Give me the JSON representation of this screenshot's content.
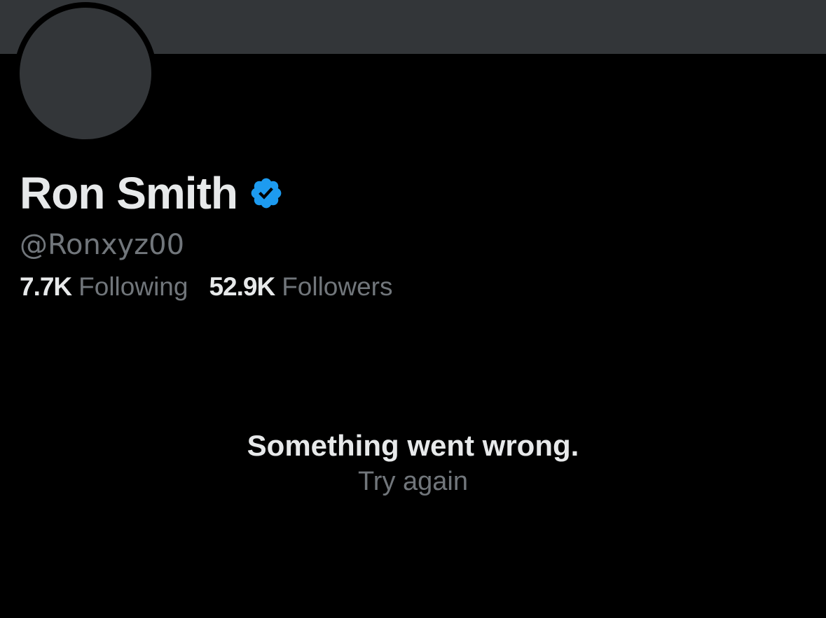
{
  "profile": {
    "display_name": "Ron Smith",
    "handle": "@Ronxyz00",
    "verified_icon": "verified-badge-icon",
    "badge_color": "#1d9bf0"
  },
  "stats": {
    "following_count": "7.7K",
    "following_label": "Following",
    "followers_count": "52.9K",
    "followers_label": "Followers"
  },
  "error": {
    "title": "Something went wrong.",
    "retry_label": "Try again"
  },
  "colors": {
    "background": "#000000",
    "banner": "#333639",
    "primary_text": "#e7e9ea",
    "secondary_text": "#71767b"
  }
}
